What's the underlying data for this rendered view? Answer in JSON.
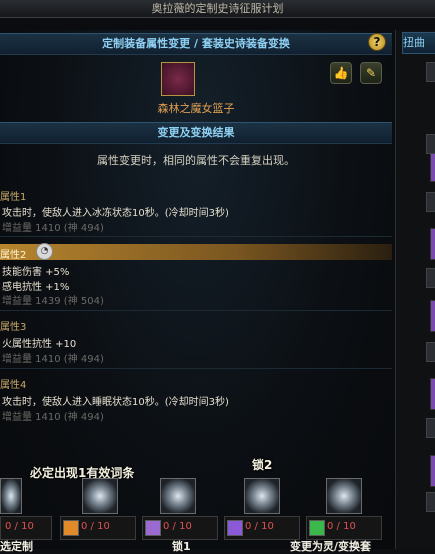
{
  "window": {
    "title": "奥拉薇的定制史诗征服计划"
  },
  "section_header": "定制装备属性变更 / 套装史诗装备变换",
  "help_label": "?",
  "item": {
    "name": "森林之魔女篮子"
  },
  "result_header": "变更及变换结果",
  "notice": "属性变更时，相同的属性不会重复出现。",
  "attributes": [
    {
      "title": "属性1",
      "lines": [
        "攻击时，使敌人进入冰冻状态10秒。(冷却时间3秒)"
      ],
      "gain": "增益量 1410 (神 494)"
    },
    {
      "title": "属性2",
      "lines": [
        "技能伤害 +5%",
        "感电抗性 +1%"
      ],
      "gain": "增益量 1439 (神 504)"
    },
    {
      "title": "属性3",
      "lines": [
        "火属性抗性 +10"
      ],
      "gain": "增益量 1410 (神 494)"
    },
    {
      "title": "属性4",
      "lines": [
        "攻击时，使敌人进入睡眠状态10秒。(冷却时间3秒)"
      ],
      "gain": "增益量 1410 (神 494)"
    }
  ],
  "hints": {
    "must_appear": "必定出现1有效词条",
    "lock2": "锁2",
    "lock1": "锁1"
  },
  "slots": [
    {
      "count": "0 / 10",
      "mini_color": "#b0b0b0"
    },
    {
      "count": "0 / 10",
      "mini_color": "#e08a2a"
    },
    {
      "count": "0 / 10",
      "mini_color": "#9b6ad0"
    },
    {
      "count": "0 / 10",
      "mini_color": "#8a5ad8"
    },
    {
      "count": "0 / 10",
      "mini_color": "#3ab84a"
    }
  ],
  "bottom": {
    "left": "选定制",
    "middle": "锁1",
    "right": "变更为灵/变换套"
  },
  "side_tab": "扭曲",
  "colors": {
    "accent": "#8fd0f2",
    "highlight": "#b8852e",
    "count_red": "#e05050"
  }
}
